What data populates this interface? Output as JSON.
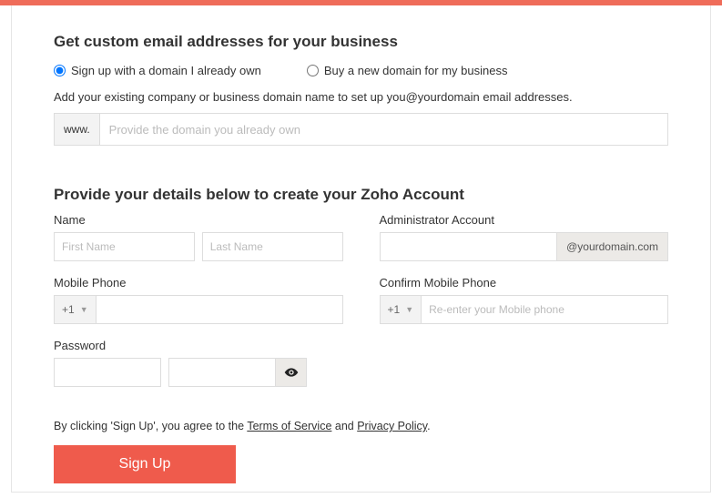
{
  "header": {
    "title": "Get custom email addresses for your business"
  },
  "domain_option": {
    "opt_own": "Sign up with a domain I already own",
    "opt_buy": "Buy a new domain for my business",
    "hint": "Add your existing company or business domain name to set up you@yourdomain email addresses.",
    "prefix": "www.",
    "placeholder": "Provide the domain you already own"
  },
  "details": {
    "title": "Provide your details below to create your Zoho Account",
    "name_label": "Name",
    "first_placeholder": "First Name",
    "last_placeholder": "Last Name",
    "admin_label": "Administrator Account",
    "admin_suffix": "@yourdomain.com",
    "mobile_label": "Mobile Phone",
    "confirm_mobile_label": "Confirm Mobile Phone",
    "phone_code": "+1",
    "confirm_phone_placeholder": "Re-enter your Mobile phone",
    "password_label": "Password"
  },
  "agree": {
    "prefix": "By clicking 'Sign Up', you agree to the ",
    "tos": "Terms of Service",
    "mid": " and ",
    "pp": "Privacy Policy",
    "suffix": "."
  },
  "button": {
    "signup": "Sign Up"
  }
}
